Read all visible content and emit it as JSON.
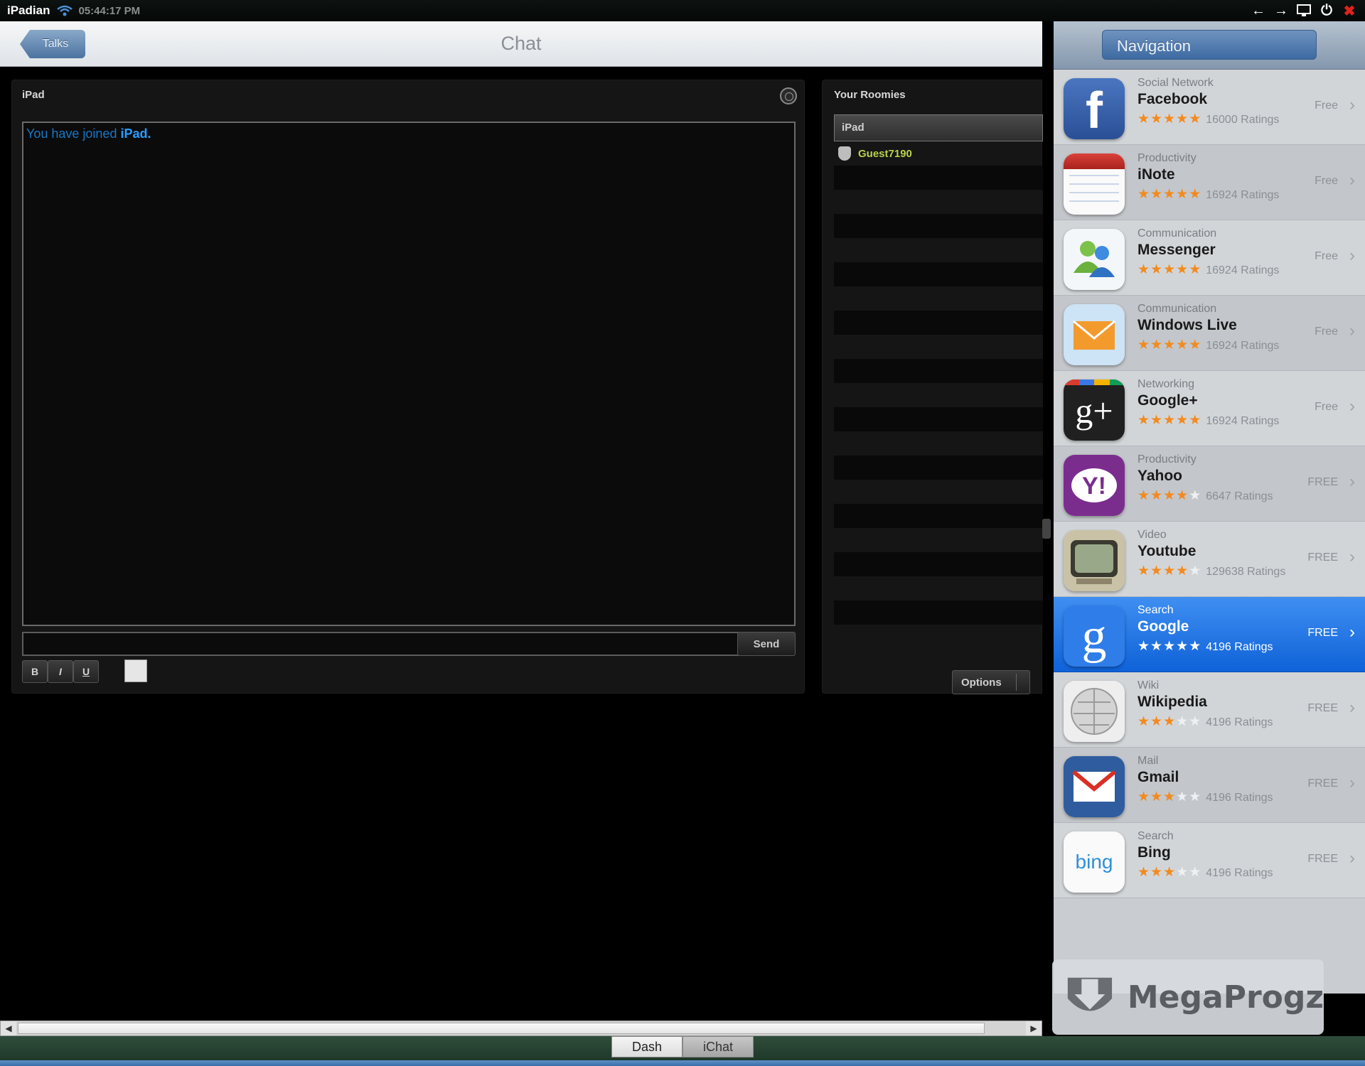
{
  "statusbar": {
    "brand": "iPadian",
    "clock": "05:44:17 PM",
    "icons": [
      "wifi-icon",
      "back-arrow-icon",
      "forward-arrow-icon",
      "display-icon",
      "power-icon",
      "close-icon"
    ]
  },
  "chat_header": {
    "back_label": "Talks",
    "title": "Chat"
  },
  "chat_panel": {
    "room_name": "iPad",
    "message_prefix": "You have joined ",
    "message_room": "iPad.",
    "send_label": "Send",
    "format": {
      "bold": "B",
      "italic": "I",
      "underline": "U"
    }
  },
  "roomies": {
    "title": "Your Roomies",
    "room": "iPad",
    "user": "Guest7190",
    "options_label": "Options"
  },
  "navigation": {
    "title": "Navigation",
    "items": [
      {
        "category": "Social Network",
        "name": "Facebook",
        "stars": 5,
        "ratings": "16000 Ratings",
        "price": "Free",
        "icon": "facebook-icon"
      },
      {
        "category": "Productivity",
        "name": "iNote",
        "stars": 5,
        "ratings": "16924 Ratings",
        "price": "Free",
        "icon": "notepad-icon"
      },
      {
        "category": "Communication",
        "name": "Messenger",
        "stars": 5,
        "ratings": "16924 Ratings",
        "price": "Free",
        "icon": "messenger-icon"
      },
      {
        "category": "Communication",
        "name": "Windows Live",
        "stars": 5,
        "ratings": "16924 Ratings",
        "price": "Free",
        "icon": "mail-envelope-icon"
      },
      {
        "category": "Networking",
        "name": "Google+",
        "stars": 5,
        "ratings": "16924 Ratings",
        "price": "Free",
        "icon": "google-plus-icon"
      },
      {
        "category": "Productivity",
        "name": "Yahoo",
        "stars": 4,
        "ratings": "6647 Ratings",
        "price": "FREE",
        "icon": "yahoo-icon"
      },
      {
        "category": "Video",
        "name": "Youtube",
        "stars": 4,
        "ratings": "129638 Ratings",
        "price": "FREE",
        "icon": "tv-icon"
      },
      {
        "category": "Search",
        "name": "Google",
        "stars": 5,
        "ratings": "4196 Ratings",
        "price": "FREE",
        "icon": "google-icon",
        "selected": true
      },
      {
        "category": "Wiki",
        "name": "Wikipedia",
        "stars": 3,
        "ratings": "4196 Ratings",
        "price": "FREE",
        "icon": "wikipedia-globe-icon"
      },
      {
        "category": "Mail",
        "name": "Gmail",
        "stars": 3,
        "ratings": "4196 Ratings",
        "price": "FREE",
        "icon": "gmail-icon"
      },
      {
        "category": "Search",
        "name": "Bing",
        "stars": 3,
        "ratings": "4196 Ratings",
        "price": "FREE",
        "icon": "bing-icon"
      }
    ]
  },
  "watermark": {
    "text": "MegaProgz"
  },
  "dock": {
    "tabs": [
      "Dash",
      "iChat"
    ]
  },
  "colors": {
    "accent_blue": "#1565d8",
    "star_orange": "#f28a1e",
    "link_blue": "#2a9cff",
    "user_green": "#b8d24a",
    "close_red": "#e0231b"
  }
}
